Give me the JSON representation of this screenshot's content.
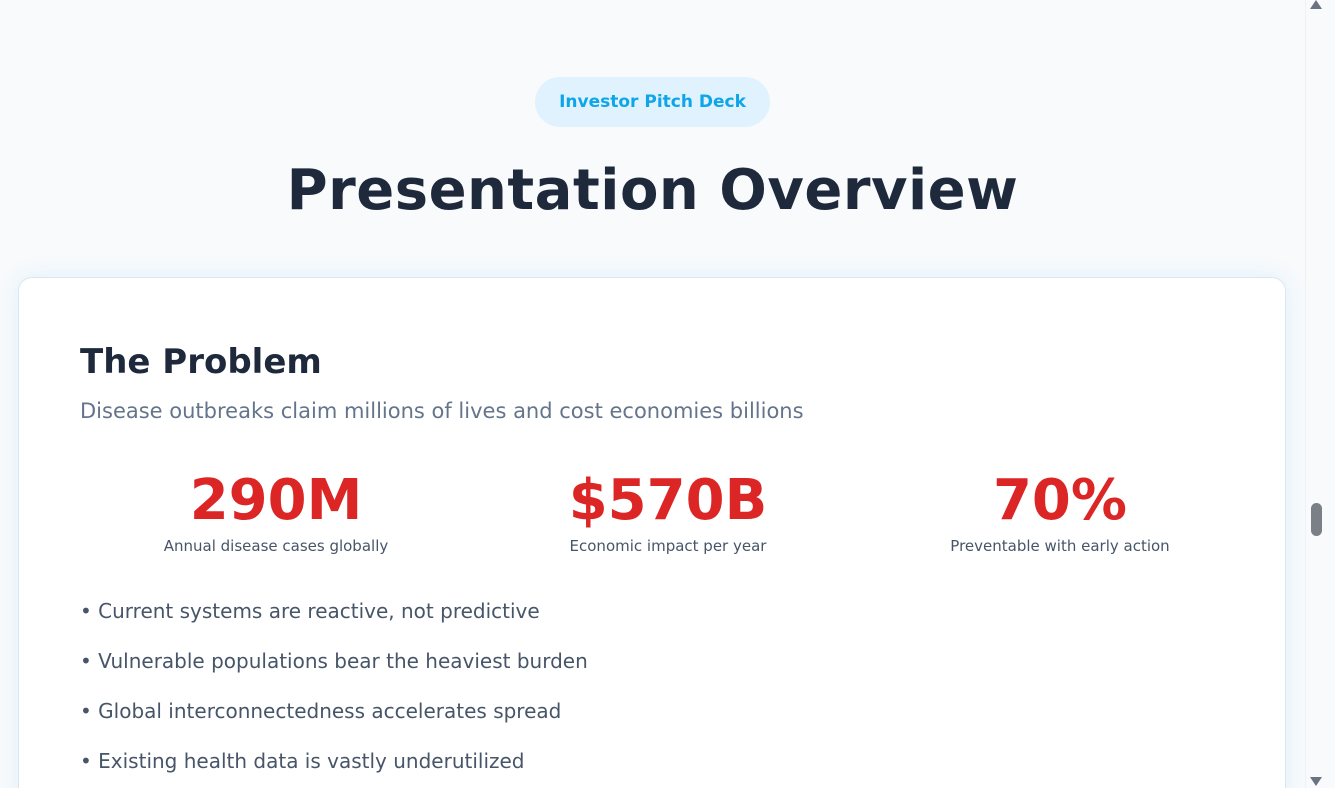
{
  "header": {
    "badge_label": "Investor Pitch Deck",
    "title": "Presentation Overview"
  },
  "problem": {
    "title": "The Problem",
    "subtitle": "Disease outbreaks claim millions of lives and cost economies billions",
    "stats": [
      {
        "value": "290M",
        "label": "Annual disease cases globally"
      },
      {
        "value": "$570B",
        "label": "Economic impact per year"
      },
      {
        "value": "70%",
        "label": "Preventable with early action"
      }
    ],
    "bullets": [
      "• Current systems are reactive, not predictive",
      "• Vulnerable populations bear the heaviest burden",
      "• Global interconnectedness accelerates spread",
      "• Existing health data is vastly underutilized"
    ]
  },
  "colors": {
    "accent": "#0ea5e9",
    "badge_bg": "#e0f2fe",
    "stat_red": "#dc2626",
    "heading": "#1e293b",
    "body_text": "#475569"
  },
  "icons": {
    "scroll_up": "scroll-up-arrow-icon",
    "scroll_down": "scroll-down-arrow-icon"
  }
}
